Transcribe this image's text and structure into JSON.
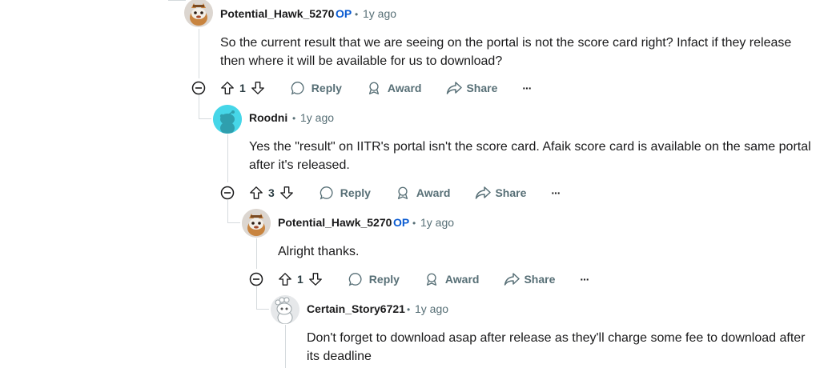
{
  "comments": [
    {
      "username": "Potential_Hawk_5270",
      "op_badge": "OP",
      "separator": "•",
      "time": "1y ago",
      "body_lines": [
        "So the current result that we are seeing on the portal is not the score card right? Infact if they release",
        "then where it will be available for us to download?"
      ],
      "votes": "1",
      "reply_label": "Reply",
      "award_label": "Award",
      "share_label": "Share",
      "more_label": "···",
      "avatar": "snoo-tan-avatar"
    },
    {
      "username": "Roodni",
      "separator": "•",
      "time": "1y ago",
      "body_lines": [
        "Yes the \"result\" on IITR's portal isn't the score card. Afaik score card is available on the same portal",
        "after it's released."
      ],
      "votes": "3",
      "reply_label": "Reply",
      "award_label": "Award",
      "share_label": "Share",
      "more_label": "···",
      "avatar": "snoo-cyan-avatar"
    },
    {
      "username": "Potential_Hawk_5270",
      "op_badge": "OP",
      "separator": "•",
      "time": "1y ago",
      "body_lines": [
        "Alright thanks."
      ],
      "votes": "1",
      "reply_label": "Reply",
      "award_label": "Award",
      "share_label": "Share",
      "more_label": "···",
      "avatar": "snoo-tan-avatar"
    },
    {
      "username": "Certain_Story6721",
      "separator": "•",
      "time": "1y ago",
      "body_lines": [
        "Don't forget to download asap after release as they'll charge some fee to download after",
        "its deadline"
      ],
      "avatar": "snoo-white-avatar"
    }
  ],
  "colors": {
    "op": "#0a5bd1",
    "meta": "#576f76",
    "thread_line": "#d5dadd",
    "cyan_avatar": "#46d6e8"
  }
}
